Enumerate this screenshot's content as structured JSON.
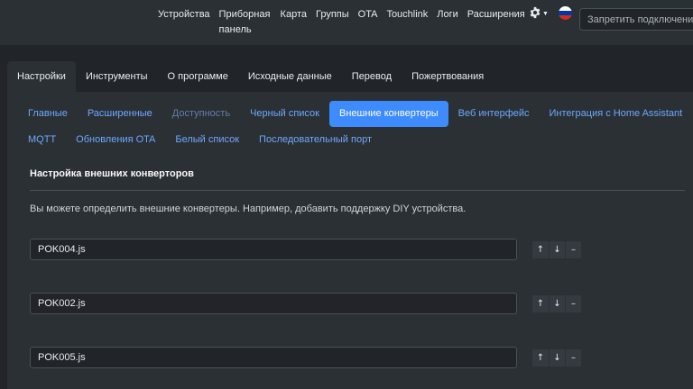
{
  "navbar": {
    "links": [
      "Устройства",
      "Приборная панель",
      "Карта",
      "Группы",
      "OTA",
      "Touchlink",
      "Логи",
      "Расширения"
    ],
    "search_placeholder": "Запретить подключения",
    "icons": {
      "settings": "gear-icon",
      "settings_dropdown": "chevron-down-icon",
      "language": "russia-flag-icon"
    },
    "flag_colors": [
      "#ffffff",
      "#0039a6",
      "#d52b1e"
    ]
  },
  "main_tabs": {
    "items": [
      "Настройки",
      "Инструменты",
      "О программе",
      "Исходные данные",
      "Перевод",
      "Пожертвования"
    ],
    "active": "Настройки"
  },
  "sub_tabs": {
    "items": [
      "Главные",
      "Расширенные",
      "Доступность",
      "Черный список",
      "Внешние конвертеры",
      "Веб интерфейс",
      "Интеграция с Home Assistant",
      "MQTT",
      "Обновления OTA",
      "Белый список",
      "Последовательный порт"
    ],
    "active": "Внешние конвертеры"
  },
  "content": {
    "title": "Настройка внешних конверторов",
    "description": "Вы можете определить внешние конвертеры. Например, добавить поддержку DIY устройства.",
    "converters": [
      "POK004.js",
      "POK002.js",
      "POK005.js"
    ],
    "row_buttons": {
      "up": "↑",
      "down": "↓",
      "remove": "–"
    }
  },
  "colors": {
    "background": "#212529",
    "surface": "#2b3035",
    "link": "#6ea8fe",
    "accent": "#3d8bfd"
  }
}
